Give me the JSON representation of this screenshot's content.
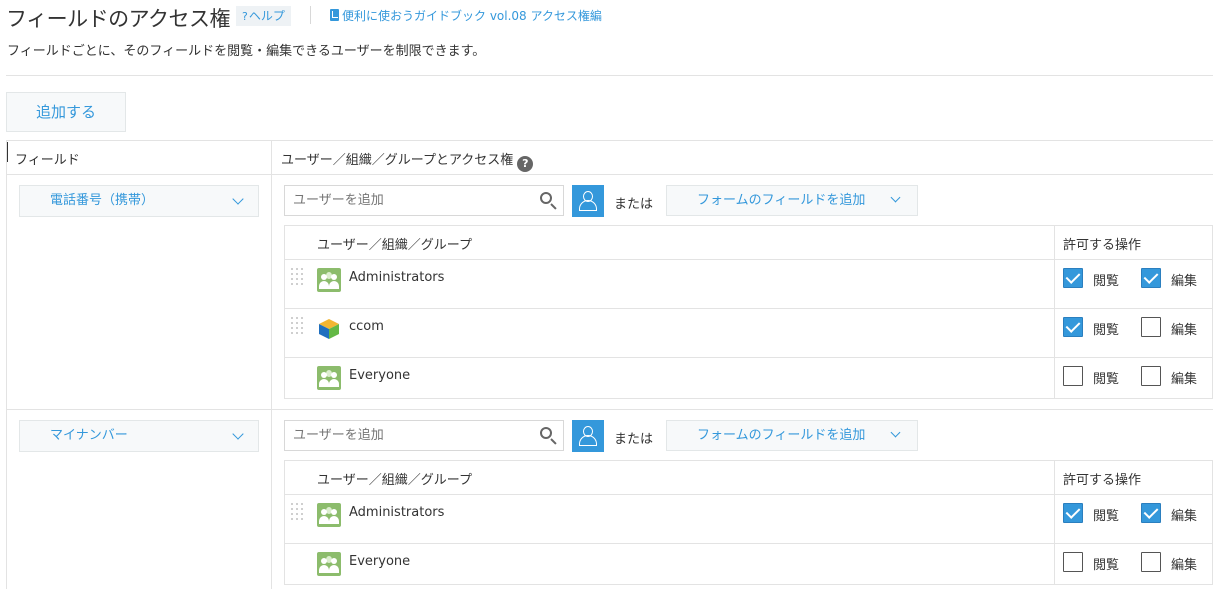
{
  "header": {
    "title": "フィールドのアクセス権",
    "help_icon": "?",
    "help_label": "ヘルプ",
    "guide_icon": "book-icon",
    "guide_label": "便利に使おうガイドブック vol.08 アクセス権編"
  },
  "description": "フィールドごとに、そのフィールドを閲覧・編集できるユーザーを制限できます。",
  "add_button": "追加する",
  "columns": {
    "field": "フィールド",
    "access": "ユーザー／組織／グループとアクセス権",
    "access_help": "?"
  },
  "rules": [
    {
      "field": "電話番号（携帯）",
      "user_input_placeholder": "ユーザーを追加",
      "or_label": "または",
      "form_field_button": "フォームのフィールドを追加",
      "table_header_entity": "ユーザー／組織／グループ",
      "table_header_ops": "許可する操作",
      "entities": [
        {
          "name": "Administrators",
          "icon": "group-icon",
          "view": true,
          "edit": true,
          "view_label": "閲覧",
          "edit_label": "編集"
        },
        {
          "name": "ccom",
          "icon": "organization-cube-icon",
          "view": true,
          "edit": false,
          "view_label": "閲覧",
          "edit_label": "編集"
        },
        {
          "name": "Everyone",
          "icon": "group-icon",
          "view": false,
          "edit": false,
          "view_label": "閲覧",
          "edit_label": "編集"
        }
      ]
    },
    {
      "field": "マイナンバー",
      "user_input_placeholder": "ユーザーを追加",
      "or_label": "または",
      "form_field_button": "フォームのフィールドを追加",
      "table_header_entity": "ユーザー／組織／グループ",
      "table_header_ops": "許可する操作",
      "entities": [
        {
          "name": "Administrators",
          "icon": "group-icon",
          "view": true,
          "edit": true,
          "view_label": "閲覧",
          "edit_label": "編集"
        },
        {
          "name": "Everyone",
          "icon": "group-icon",
          "view": false,
          "edit": false,
          "view_label": "閲覧",
          "edit_label": "編集"
        }
      ]
    }
  ],
  "colors": {
    "accent": "#3498db",
    "border": "#e3e3e3",
    "group_icon": "#8cbc6c"
  }
}
